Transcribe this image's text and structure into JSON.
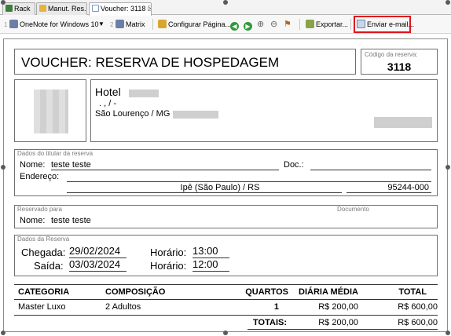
{
  "tabs": [
    {
      "label": "Rack"
    },
    {
      "label": "Manut. Res."
    },
    {
      "label": "Voucher: 3118",
      "close": "☒"
    }
  ],
  "toolbar": {
    "step1": "1",
    "onenote": "OneNote for Windows 10",
    "step2": "2",
    "matrix": "Matrix",
    "page_setup": "Configurar Página...",
    "export": "Exportar...",
    "email": "Enviar e-mail..."
  },
  "voucher": {
    "title": "VOUCHER:  RESERVA DE HOSPEDAGEM",
    "code_legend": "Código da reserva:",
    "code": "3118",
    "hotel_name": "Hotel",
    "hotel_addr": ". , / -",
    "hotel_city": "São Lourenço / MG",
    "holder": {
      "legend": "Dados do titular da reserva",
      "name_label": "Nome:",
      "name": "teste teste",
      "doc_label": "Doc.:",
      "doc": "",
      "address_label": "Endereço:",
      "address": "",
      "city": "Ipê (São Paulo) / RS",
      "zip": "95244-000"
    },
    "reserved_for": {
      "legend": "Reservado para",
      "doc_legend": "Documento",
      "name_label": "Nome:",
      "name": "teste teste"
    },
    "stay": {
      "legend": "Dados da Reserva",
      "arrival_label": "Chegada:",
      "arrival": "29/02/2024",
      "arrival_time_label": "Horário:",
      "arrival_time": "13:00",
      "departure_label": "Saída:",
      "departure": "03/03/2024",
      "departure_time_label": "Horário:",
      "departure_time": "12:00"
    },
    "table": {
      "headers": {
        "category": "CATEGORIA",
        "composition": "COMPOSIÇÃO",
        "rooms": "QUARTOS",
        "daily": "DIÁRIA MÉDIA",
        "total": "TOTAL"
      },
      "rows": [
        {
          "category": "Master Luxo",
          "composition": "2 Adultos",
          "rooms": "1",
          "daily": "R$ 200,00",
          "total": "R$ 600,00"
        }
      ],
      "totals_label": "TOTAIS:",
      "totals_daily": "R$ 200,00",
      "totals_total": "R$ 600,00"
    }
  }
}
